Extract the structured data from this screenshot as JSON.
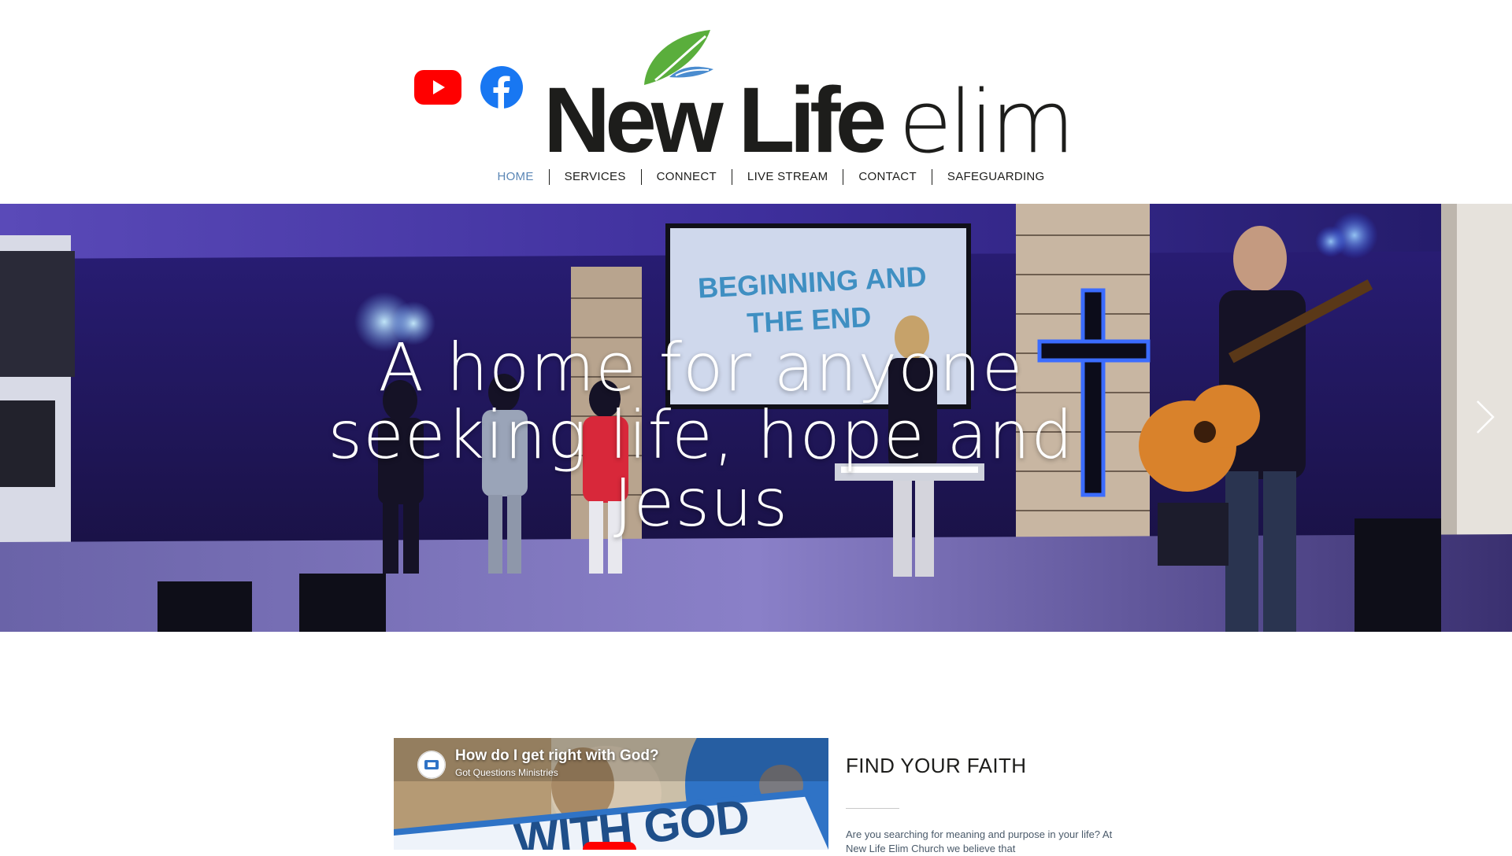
{
  "header": {
    "social": {
      "youtube_icon": "youtube-icon",
      "facebook_icon": "facebook-icon"
    },
    "logo": {
      "word_bold": "New Life",
      "word_light": "elim",
      "leaf_icon": "leaf-icon"
    }
  },
  "nav": {
    "items": [
      {
        "label": "HOME",
        "active": true
      },
      {
        "label": "SERVICES"
      },
      {
        "label": "CONNECT"
      },
      {
        "label": "LIVE STREAM"
      },
      {
        "label": "CONTACT"
      },
      {
        "label": "SAFEGUARDING"
      }
    ]
  },
  "hero": {
    "heading": "A home for anyone seeking life, hope and Jesus",
    "screen_text_1": "BEGINNING AND",
    "screen_text_2": "THE END",
    "next_icon": "chevron-right-icon"
  },
  "video": {
    "title": "How do I get right with God?",
    "channel": "Got Questions Ministries",
    "thumbnail_text": "WITH GOD"
  },
  "faith": {
    "heading": "FIND YOUR FAITH",
    "body": "Are you searching for meaning and purpose in your life? At New Life Elim Church we believe that"
  },
  "colors": {
    "nav_active": "#5a86b5",
    "text_dark": "#1d1d1b",
    "youtube_red": "#ff0000",
    "facebook_blue": "#1877f2",
    "leaf_green": "#5aae3c",
    "leaf_blue": "#4a8ccf"
  }
}
